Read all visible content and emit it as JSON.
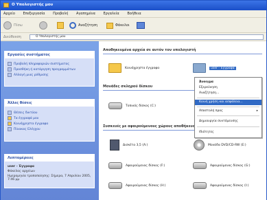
{
  "window": {
    "title": "Ο Υπολογιστής μου"
  },
  "menubar": [
    "Αρχείο",
    "Επεξεργασία",
    "Προβολή",
    "Αγαπημένα",
    "Εργαλεία",
    "Βοήθεια"
  ],
  "toolbar": {
    "back_label": "Πίσω",
    "search_label": "Αναζήτηση",
    "folders_label": "Φάκελοι"
  },
  "address": {
    "label": "Διεύθυνση",
    "value": "Ο Υπολογιστής μου"
  },
  "left_panels": {
    "tasks": {
      "title": "Εργασίες συστήματος",
      "items": [
        "Προβολή πληροφοριών συστήματος",
        "Προσθήκη ή κατάργηση προγραμμάτων",
        "Αλλαγή μιας ρύθμισης"
      ]
    },
    "places": {
      "title": "Άλλες θέσεις",
      "items": [
        "Θέσεις δικτύου",
        "Τα έγγραφά μου",
        "Κοινόχρηστα έγγραφα",
        "Πίνακας Ελέγχου"
      ]
    },
    "details": {
      "title": "Λεπτομέρειες",
      "name": "user - Έγγραφα",
      "type": "Φάκελος αρχείων",
      "text": "Ημερομηνία τροποποίησης: Σήμερα, 7 Απριλίου 2005, 7:46 μμ"
    }
  },
  "content": {
    "section_files": "Αποθηκευμένα αρχεία σε αυτόν τον υπολογιστή",
    "section_hdd": "Μονάδες σκληρού δίσκου",
    "section_removable": "Συσκευές με αφαιρούμενους χώρους αποθήκευσης",
    "items": {
      "shared_docs": "Κοινόχρηστα έγγραφα",
      "user_docs": "user - Έγγραφα",
      "local_c": "Τοπικός δίσκος (C:)",
      "floppy_a": "Δισκέτα 3,5 (A:)",
      "cd_e": "Μονάδα DVD/CD-RW (E:)",
      "removable_f": "Αφαιρούμενος δίσκος (F:)",
      "removable_g": "Αφαιρούμενος δίσκος (G:)",
      "removable_h": "Αφαιρούμενος δίσκος (H:)",
      "removable_i": "Αφαιρούμενος δίσκος (I:)"
    }
  },
  "context_menu": {
    "items": [
      "Άνοιγμα",
      "Εξερεύνηση",
      "Αναζήτηση...",
      "Κοινή χρήση και ασφάλεια...",
      "Αποστολή προς",
      "Δημιουργία συντόμευσης",
      "Ιδιότητες"
    ],
    "selected_index": 3
  }
}
